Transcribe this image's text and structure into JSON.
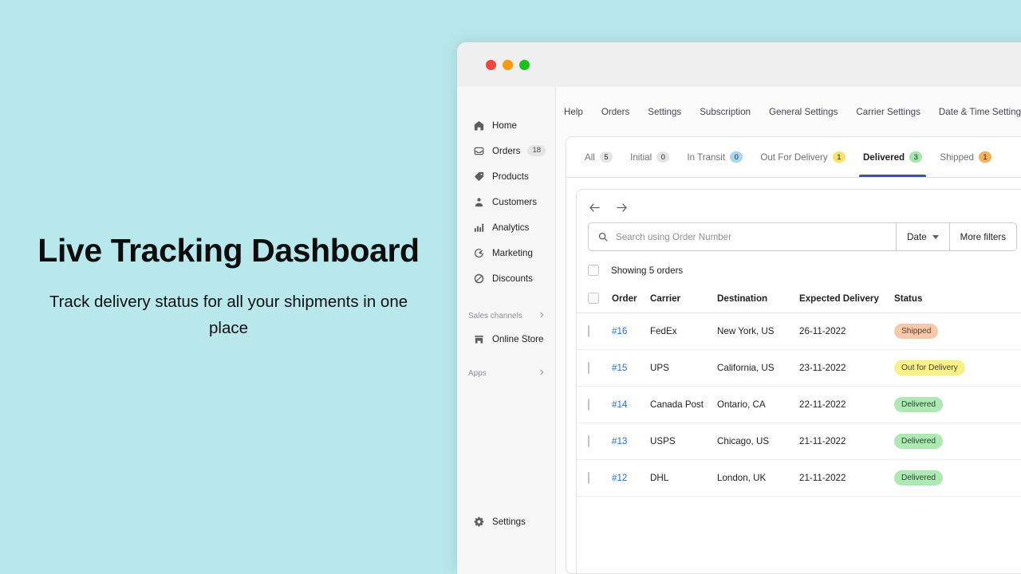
{
  "promo": {
    "title": "Live Tracking Dashboard",
    "subtitle": "Track delivery status for all your shipments in one place"
  },
  "window": {
    "traffic_lights": [
      "close",
      "minimize",
      "maximize"
    ],
    "colors": {
      "close": "#f1453d",
      "minimize": "#f99a0b",
      "maximize": "#19c21a",
      "accent": "#3f51b5",
      "link": "#2c6ecb",
      "page_background": "#b9e8ec"
    }
  },
  "sidebar": {
    "items": [
      {
        "label": "Home",
        "icon": "home-icon",
        "badge": ""
      },
      {
        "label": "Orders",
        "icon": "orders-icon",
        "badge": "18"
      },
      {
        "label": "Products",
        "icon": "products-tag-icon",
        "badge": ""
      },
      {
        "label": "Customers",
        "icon": "customers-person-icon",
        "badge": ""
      },
      {
        "label": "Analytics",
        "icon": "analytics-bars-icon",
        "badge": ""
      },
      {
        "label": "Marketing",
        "icon": "marketing-target-icon",
        "badge": ""
      },
      {
        "label": "Discounts",
        "icon": "discounts-icon",
        "badge": ""
      }
    ],
    "sales_channels": {
      "label": "Sales channels",
      "icon": "chevron-right-icon"
    },
    "online_store": {
      "label": "Online Store",
      "icon": "store-icon"
    },
    "apps": {
      "label": "Apps",
      "icon": "chevron-right-icon"
    },
    "settings": {
      "label": "Settings",
      "icon": "gear-icon"
    }
  },
  "topnav": {
    "items": [
      "Help",
      "Orders",
      "Settings",
      "Subscription",
      "General Settings",
      "Carrier Settings",
      "Date & Time Settings"
    ]
  },
  "tabs": [
    {
      "label": "All",
      "count": "5",
      "badge_color": "#e4e5e7",
      "active": false
    },
    {
      "label": "Initial",
      "count": "0",
      "badge_color": "#e4e5e7",
      "active": false
    },
    {
      "label": "In Transit",
      "count": "0",
      "badge_color": "#a9d7f2",
      "active": false
    },
    {
      "label": "Out For Delivery",
      "count": "1",
      "badge_color": "#f6e36c",
      "active": false
    },
    {
      "label": "Delivered",
      "count": "3",
      "badge_color": "#a6e6ab",
      "active": true
    },
    {
      "label": "Shipped",
      "count": "1",
      "badge_color": "#f5b05a",
      "active": false
    }
  ],
  "toolbar": {
    "back_icon": "arrow-left-icon",
    "forward_icon": "arrow-right-icon",
    "search_icon": "search-icon",
    "search_value": "",
    "search_placeholder": "Search using Order Number",
    "date_label": "Date",
    "more_filters_label": "More filters",
    "showing_label": "Showing 5 orders"
  },
  "table": {
    "columns": [
      "Order",
      "Carrier",
      "Destination",
      "Expected Delivery",
      "Status"
    ],
    "rows": [
      {
        "order": "#16",
        "carrier": "FedEx",
        "destination": "New York, US",
        "expected_delivery": "26-11-2022",
        "status": "Shipped",
        "status_bg": "#f7c9ac",
        "status_fg": "#5c3b22"
      },
      {
        "order": "#15",
        "carrier": "UPS",
        "destination": "California, US",
        "expected_delivery": "23-11-2022",
        "status": "Out for Delivery",
        "status_bg": "#f6ef8a",
        "status_fg": "#4a4520"
      },
      {
        "order": "#14",
        "carrier": "Canada Post",
        "destination": "Ontario, CA",
        "expected_delivery": "22-11-2022",
        "status": "Delivered",
        "status_bg": "#aee8b2",
        "status_fg": "#23462a"
      },
      {
        "order": "#13",
        "carrier": "USPS",
        "destination": "Chicago, US",
        "expected_delivery": "21-11-2022",
        "status": "Delivered",
        "status_bg": "#aee8b2",
        "status_fg": "#23462a"
      },
      {
        "order": "#12",
        "carrier": "DHL",
        "destination": "London, UK",
        "expected_delivery": "21-11-2022",
        "status": "Delivered",
        "status_bg": "#aee8b2",
        "status_fg": "#23462a"
      }
    ]
  }
}
